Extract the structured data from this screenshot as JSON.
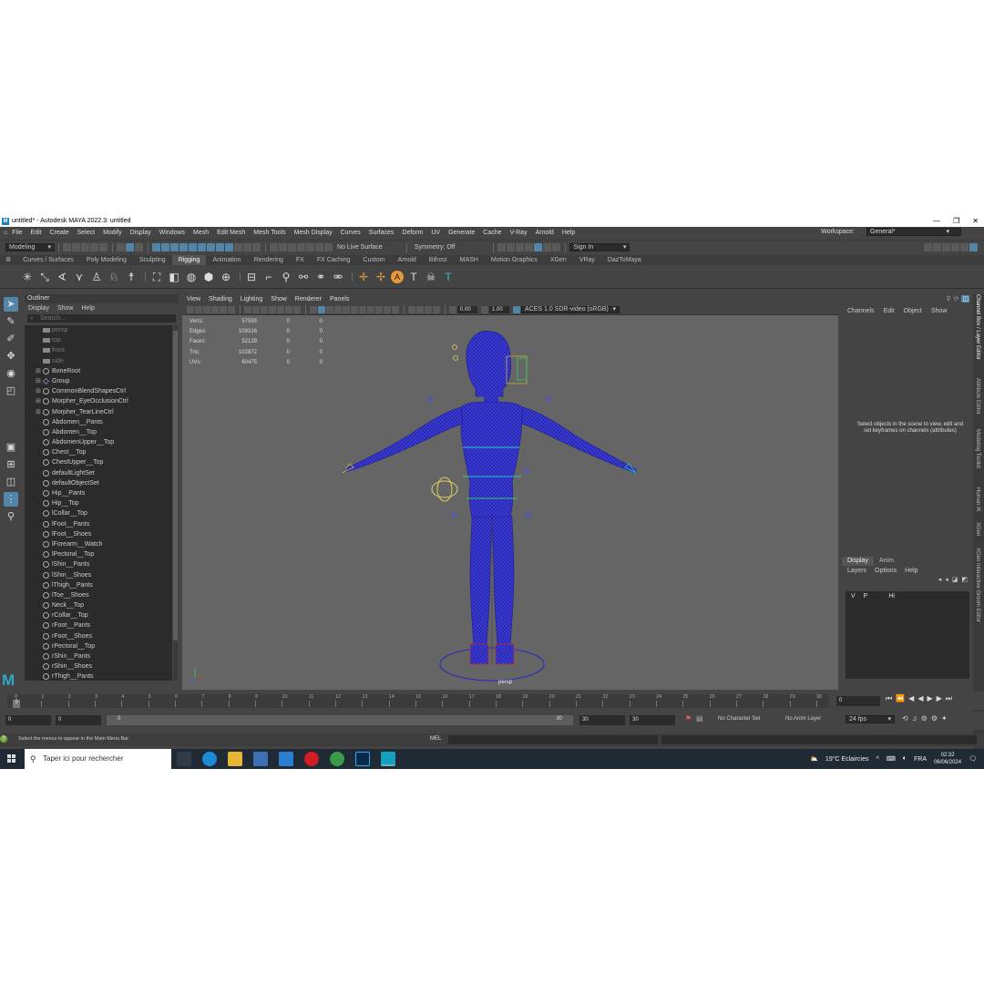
{
  "window": {
    "title": "untitled* - Autodesk MAYA 2022.3: untitled",
    "logo": "M",
    "min_icon": "minimize-icon",
    "restore_icon": "restore-icon",
    "close_icon": "close-icon"
  },
  "menubar": {
    "items": [
      "File",
      "Edit",
      "Create",
      "Select",
      "Modify",
      "Display",
      "Windows",
      "Mesh",
      "Edit Mesh",
      "Mesh Tools",
      "Mesh Display",
      "Curves",
      "Surfaces",
      "Deform",
      "UV",
      "Generate",
      "Cache",
      "V-Ray",
      "Arnold",
      "Help"
    ],
    "workspace_label": "Workspace:",
    "workspace_value": "General*"
  },
  "statusline": {
    "mode": "Modeling",
    "live_surface": "No Live Surface",
    "symmetry": "Symmetry: Off",
    "sign_in": "Sign In"
  },
  "shelf": {
    "tabs": [
      "Curves / Surfaces",
      "Poly Modeling",
      "Sculpting",
      "Rigging",
      "Animation",
      "Rendering",
      "FX",
      "FX Caching",
      "Custom",
      "Arnold",
      "Bifrost",
      "MASH",
      "Motion Graphics",
      "XGen",
      "VRay",
      "DazToMaya"
    ],
    "active_tab": "Rigging"
  },
  "outliner": {
    "title": "Outliner",
    "menu": [
      "Display",
      "Show",
      "Help"
    ],
    "search_placeholder": "Search...",
    "items": [
      {
        "name": "persp",
        "kind": "camera",
        "dim": true
      },
      {
        "name": "top",
        "kind": "camera",
        "dim": true
      },
      {
        "name": "front",
        "kind": "camera",
        "dim": true
      },
      {
        "name": "side",
        "kind": "camera",
        "dim": true
      },
      {
        "name": "BoneRoot",
        "kind": "joint",
        "expand": true
      },
      {
        "name": "Group",
        "kind": "group",
        "expand": true
      },
      {
        "name": "CommonBlendShapesCtrl",
        "kind": "joint",
        "expand": true
      },
      {
        "name": "Morpher_EyeOcclusionCtrl",
        "kind": "joint",
        "expand": true
      },
      {
        "name": "Morpher_TearLineCtrl",
        "kind": "joint",
        "expand": true
      },
      {
        "name": "Abdomen__Pants",
        "kind": "set"
      },
      {
        "name": "Abdomen__Top",
        "kind": "set"
      },
      {
        "name": "AbdomenUpper__Top",
        "kind": "set"
      },
      {
        "name": "Chest__Top",
        "kind": "set"
      },
      {
        "name": "ChestUpper__Top",
        "kind": "set"
      },
      {
        "name": "defaultLightSet",
        "kind": "set"
      },
      {
        "name": "defaultObjectSet",
        "kind": "set"
      },
      {
        "name": "Hip__Pants",
        "kind": "set"
      },
      {
        "name": "Hip__Top",
        "kind": "set"
      },
      {
        "name": "lCollar__Top",
        "kind": "set"
      },
      {
        "name": "lFoot__Pants",
        "kind": "set"
      },
      {
        "name": "lFoot__Shoes",
        "kind": "set"
      },
      {
        "name": "lForearm__Watch",
        "kind": "set"
      },
      {
        "name": "lPectoral__Top",
        "kind": "set"
      },
      {
        "name": "lShin__Pants",
        "kind": "set"
      },
      {
        "name": "lShin__Shoes",
        "kind": "set"
      },
      {
        "name": "lThigh__Pants",
        "kind": "set"
      },
      {
        "name": "lToe__Shoes",
        "kind": "set"
      },
      {
        "name": "Neck__Top",
        "kind": "set"
      },
      {
        "name": "rCollar__Top",
        "kind": "set"
      },
      {
        "name": "rFoot__Pants",
        "kind": "set"
      },
      {
        "name": "rFoot__Shoes",
        "kind": "set"
      },
      {
        "name": "rPectoral__Top",
        "kind": "set"
      },
      {
        "name": "rShin__Pants",
        "kind": "set"
      },
      {
        "name": "rShin__Shoes",
        "kind": "set"
      },
      {
        "name": "rThigh__Pants",
        "kind": "set"
      }
    ]
  },
  "viewport": {
    "menu": [
      "View",
      "Shading",
      "Lighting",
      "Show",
      "Renderer",
      "Panels"
    ],
    "exposure": "0.00",
    "gamma": "1.00",
    "color_space": "ACES 1.0 SDR-video (sRGB)",
    "camera_label": "persp",
    "hud": [
      {
        "label": "Verts:",
        "value": "57593",
        "sel": "0",
        "comp": "0"
      },
      {
        "label": "Edges:",
        "value": "109316",
        "sel": "0",
        "comp": "0"
      },
      {
        "label": "Faces:",
        "value": "52129",
        "sel": "0",
        "comp": "0"
      },
      {
        "label": "Tris:",
        "value": "102872",
        "sel": "0",
        "comp": "0"
      },
      {
        "label": "UVs:",
        "value": "60475",
        "sel": "0",
        "comp": "0"
      }
    ],
    "wire_color": "#2a2ab8"
  },
  "channelbox": {
    "menu": [
      "Channels",
      "Edit",
      "Object",
      "Show"
    ],
    "hint": "Select objects in the scene to view, edit and set keyframes on channels (attributes)"
  },
  "side_tabs": [
    "Channel Box / Layer Editor",
    "Attribute Editor",
    "Modeling Toolkit",
    "Human IK",
    "XGen",
    "XGen Interactive Groom Editor"
  ],
  "layers": {
    "tabs": [
      "Display",
      "Anim"
    ],
    "menu": [
      "Layers",
      "Options",
      "Help"
    ],
    "row": {
      "v": "V",
      "p": "P",
      "name": "Hi"
    }
  },
  "timeslider": {
    "ticks": [
      "0",
      "1",
      "2",
      "3",
      "4",
      "5",
      "6",
      "7",
      "8",
      "9",
      "10",
      "11",
      "12",
      "13",
      "14",
      "15",
      "16",
      "17",
      "18",
      "19",
      "20",
      "21",
      "22",
      "23",
      "24",
      "25",
      "26",
      "27",
      "28",
      "29",
      "30"
    ],
    "current": "0",
    "current_field": "0"
  },
  "range": {
    "start": "0",
    "start2": "0",
    "slider_start": "0",
    "slider_end": "30",
    "end": "30",
    "end2": "30",
    "char_set": "No Character Set",
    "anim_layer": "No Anim Layer",
    "fps": "24 fps"
  },
  "commandline": {
    "help": "Select the menus to appear in the Main Menu Bar",
    "lang": "MEL"
  },
  "taskbar": {
    "search": "Taper ici pour rechercher",
    "weather": "19°C  Eclaircies",
    "lang": "FRA",
    "time": "02:32",
    "date": "06/06/2024"
  }
}
